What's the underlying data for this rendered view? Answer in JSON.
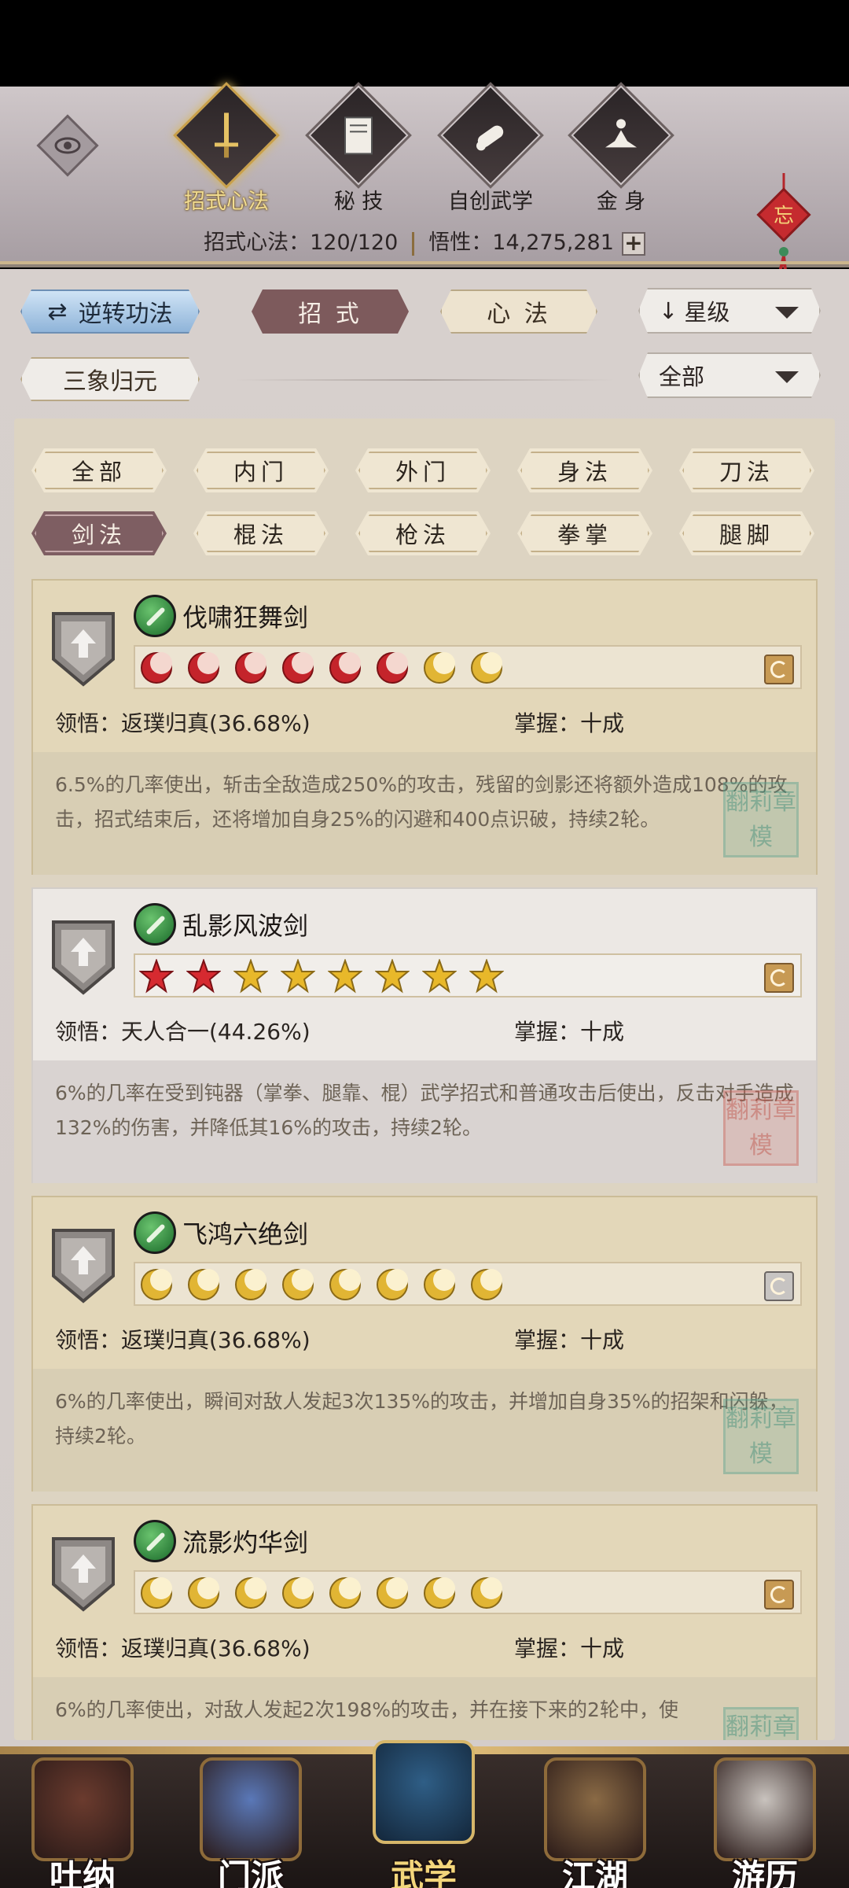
{
  "header": {
    "tabs": [
      {
        "label": "招式心法",
        "active": true,
        "icon": "sword-icon"
      },
      {
        "label": "秘 技",
        "active": false,
        "icon": "book-icon"
      },
      {
        "label": "自创武学",
        "active": false,
        "icon": "scroll-icon"
      },
      {
        "label": "金 身",
        "active": false,
        "icon": "meditation-icon"
      }
    ],
    "stats": {
      "label1": "招式心法：120/120",
      "label2": "悟性：14,275,281"
    },
    "knot_char": "忘"
  },
  "controls": {
    "reverse_label": "逆转功法",
    "tab_moves": "招 式",
    "tab_mind": "心 法",
    "sort_select": "星级",
    "sanxiang_label": "三象归元",
    "filter_select": "全部"
  },
  "filters": [
    "全部",
    "内门",
    "外门",
    "身法",
    "刀法",
    "剑法",
    "棍法",
    "枪法",
    "拳掌",
    "腿脚"
  ],
  "active_filter": "剑法",
  "cards": [
    {
      "name": "伐啸狂舞剑",
      "stars": [
        "red-moon",
        "red-moon",
        "red-moon",
        "red-moon",
        "red-moon",
        "red-moon",
        "gold-moon",
        "gold-moon"
      ],
      "rune": "gold",
      "comprehension": "领悟：返璞归真(36.68%)",
      "mastery": "掌握：十成",
      "desc": "6.5%的几率使出，斩击全敌造成250%的攻击，残留的剑影还将额外造成108%的攻击，招式结束后，还将增加自身25%的闪避和400点识破，持续2轮。",
      "seal": "green",
      "selected": false
    },
    {
      "name": "乱影风波剑",
      "stars": [
        "red-star",
        "red-star",
        "gold-star",
        "gold-star",
        "gold-star",
        "gold-star",
        "gold-star",
        "gold-star"
      ],
      "rune": "gold",
      "comprehension": "领悟：天人合一(44.26%)",
      "mastery": "掌握：十成",
      "desc": "6%的几率在受到钝器（掌拳、腿靠、棍）武学招式和普通攻击后使出，反击对手造成132%的伤害，并降低其16%的攻击，持续2轮。",
      "seal": "red",
      "selected": true
    },
    {
      "name": "飞鸿六绝剑",
      "stars": [
        "gold-moon",
        "gold-moon",
        "gold-moon",
        "gold-moon",
        "gold-moon",
        "gold-moon",
        "gold-moon",
        "gold-moon"
      ],
      "rune": "grey",
      "comprehension": "领悟：返璞归真(36.68%)",
      "mastery": "掌握：十成",
      "desc": "6%的几率使出，瞬间对敌人发起3次135%的攻击，并增加自身35%的招架和闪躲，持续2轮。",
      "seal": "green",
      "selected": false
    },
    {
      "name": "流影灼华剑",
      "stars": [
        "gold-moon",
        "gold-moon",
        "gold-moon",
        "gold-moon",
        "gold-moon",
        "gold-moon",
        "gold-moon",
        "gold-moon"
      ],
      "rune": "gold",
      "comprehension": "领悟：返璞归真(36.68%)",
      "mastery": "掌握：十成",
      "desc": "6%的几率使出，对敌人发起2次198%的攻击，并在接下来的2轮中，使",
      "seal": "green",
      "selected": false
    }
  ],
  "seal_text": [
    "翻",
    "莉",
    "章",
    "模"
  ],
  "bottom_nav": [
    {
      "label": "吐纳",
      "active": false
    },
    {
      "label": "门派",
      "active": false
    },
    {
      "label": "武学",
      "active": true
    },
    {
      "label": "江湖",
      "active": false
    },
    {
      "label": "游历",
      "active": false
    }
  ],
  "colors": {
    "accent_maroon": "#7d5a5c",
    "gold": "#e1b534",
    "red": "#c4242b"
  }
}
